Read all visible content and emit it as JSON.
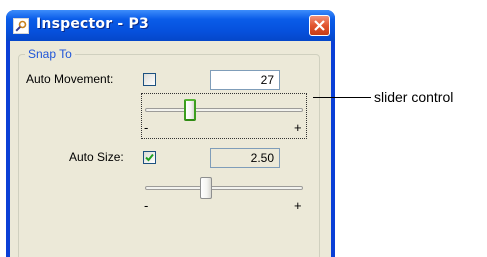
{
  "window": {
    "title": "Inspector - P3",
    "icon": "inspector-icon",
    "close_icon": "close-icon"
  },
  "group": {
    "legend": "Snap To"
  },
  "auto_movement": {
    "label": "Auto Movement:",
    "checked": false,
    "value": "27",
    "slider_min_label": "-",
    "slider_max_label": "+",
    "slider_level": 0.27
  },
  "auto_size": {
    "label": "Auto Size:",
    "checked": true,
    "value": "2.50",
    "slider_min_label": "-",
    "slider_max_label": "+",
    "slider_level": 0.38
  },
  "annotation": {
    "text": "slider control"
  },
  "colors": {
    "titlebar": "#0650dc",
    "client_bg": "#ece9d8",
    "legend_text": "#1f55d9",
    "close_button": "#e2552f",
    "active_thumb": "#3c9e1e"
  }
}
